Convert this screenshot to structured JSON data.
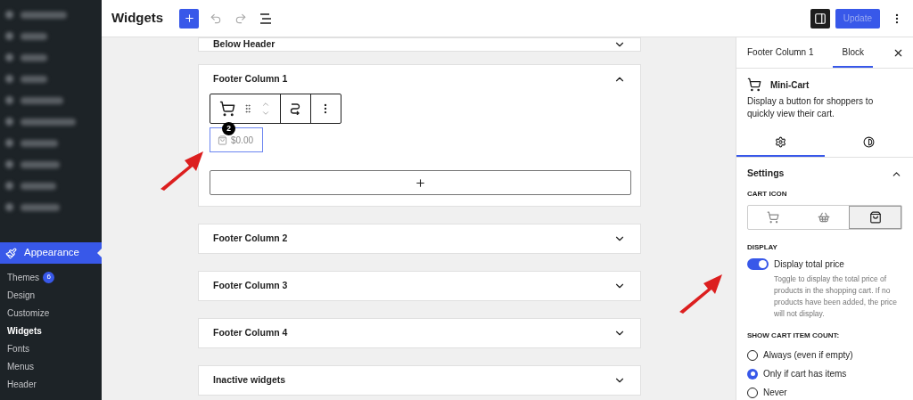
{
  "sidebar": {
    "section": {
      "label": "Appearance",
      "selected": true
    },
    "items": [
      {
        "label": "Themes",
        "badge": "6",
        "selected": false
      },
      {
        "label": "Design",
        "selected": false
      },
      {
        "label": "Customize",
        "selected": false
      },
      {
        "label": "Widgets",
        "selected": true
      },
      {
        "label": "Fonts",
        "selected": false
      },
      {
        "label": "Menus",
        "selected": false
      },
      {
        "label": "Header",
        "selected": false
      }
    ]
  },
  "header": {
    "title": "Widgets",
    "update_button": {
      "label": "Update",
      "disabled": true
    }
  },
  "areas": [
    {
      "title": "Below Header",
      "expanded": false
    },
    {
      "title": "Footer Column 1",
      "expanded": true,
      "price": "$0.00",
      "count": "2"
    },
    {
      "title": "Footer Column 2",
      "expanded": false
    },
    {
      "title": "Footer Column 3",
      "expanded": false
    },
    {
      "title": "Footer Column 4",
      "expanded": false
    },
    {
      "title": "Inactive widgets",
      "expanded": false
    }
  ],
  "inspector": {
    "tabs": [
      {
        "label": "Footer Column 1",
        "selected": false
      },
      {
        "label": "Block",
        "selected": true
      }
    ],
    "block_name": "Mini-Cart",
    "block_description": "Display a button for shoppers to quickly view their cart.",
    "panel_tabs": [
      {
        "kind": "settings",
        "selected": true
      },
      {
        "kind": "styles",
        "selected": false
      }
    ],
    "settings_title": "Settings",
    "settings_expanded": true,
    "cart_icon_label": "CART ICON",
    "cart_icons": [
      {
        "kind": "cart",
        "selected": false
      },
      {
        "kind": "basket",
        "selected": false
      },
      {
        "kind": "bag",
        "selected": true
      }
    ],
    "display_label": "DISPLAY",
    "toggle": {
      "label": "Display total price",
      "on": true,
      "help": "Toggle to display the total price of products in the shopping cart. If no products have been added, the price will not display."
    },
    "count_label": "SHOW CART ITEM COUNT:",
    "count_options": [
      {
        "label": "Always (even if empty)",
        "selected": false
      },
      {
        "label": "Only if cart has items",
        "selected": true
      },
      {
        "label": "Never",
        "selected": false
      }
    ]
  }
}
